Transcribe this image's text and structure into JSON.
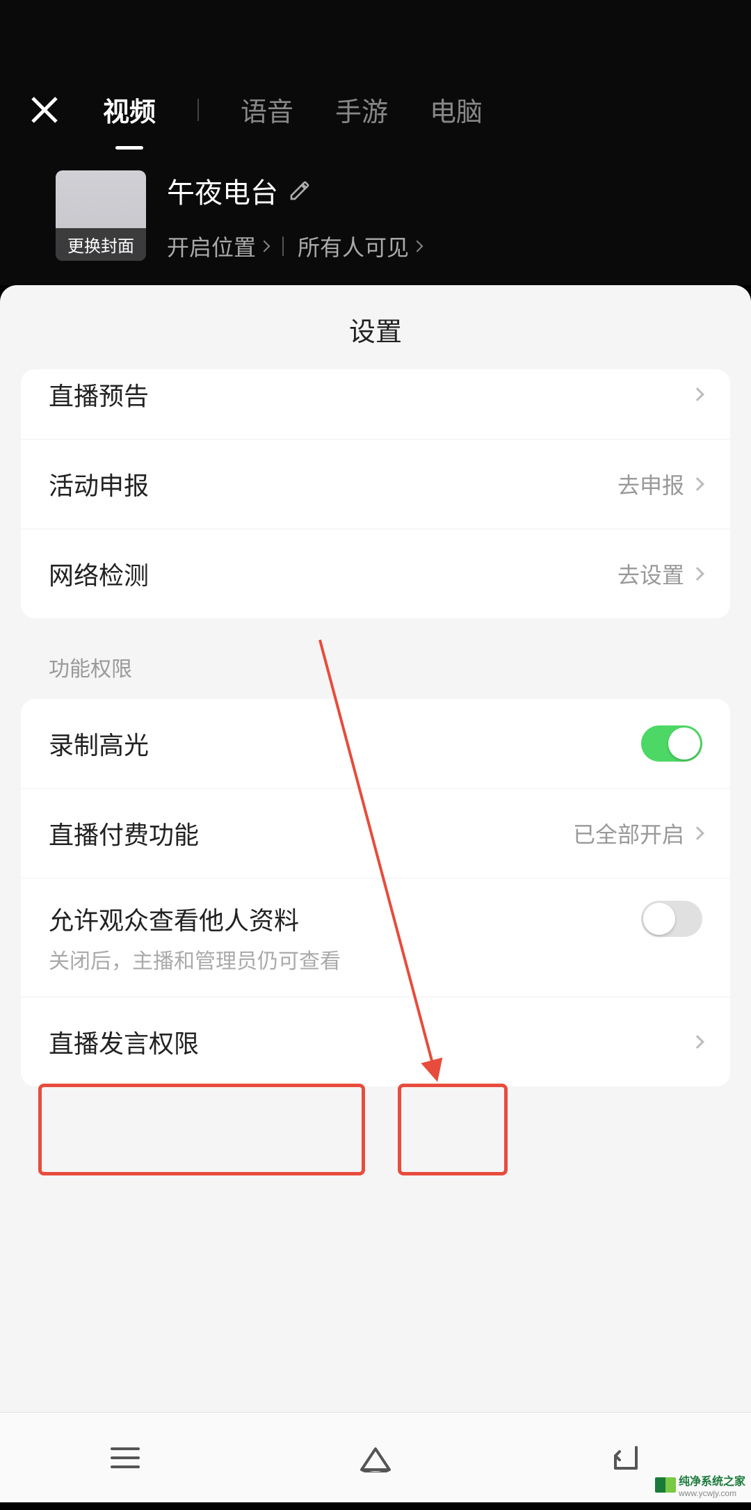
{
  "header": {
    "tabs": [
      "视频",
      "语音",
      "手游",
      "电脑"
    ],
    "active_tab_index": 0
  },
  "stream": {
    "title": "午夜电台",
    "cover_label": "更换封面",
    "location_label": "开启位置",
    "visibility_label": "所有人可见"
  },
  "panel": {
    "title": "设置",
    "group1": [
      {
        "label": "直播预告",
        "right": ""
      },
      {
        "label": "活动申报",
        "right": "去申报"
      },
      {
        "label": "网络检测",
        "right": "去设置"
      }
    ],
    "section_label": "功能权限",
    "group2": {
      "record_highlight": {
        "label": "录制高光",
        "toggle": true
      },
      "paid_feature": {
        "label": "直播付费功能",
        "right": "已全部开启"
      },
      "view_profile": {
        "label": "允许观众查看他人资料",
        "sub": "关闭后，主播和管理员仍可查看",
        "toggle": false
      },
      "speak_permission": {
        "label": "直播发言权限"
      }
    }
  },
  "watermark": {
    "brand": "纯净系统之家",
    "url": "www.ycwjy.com"
  }
}
